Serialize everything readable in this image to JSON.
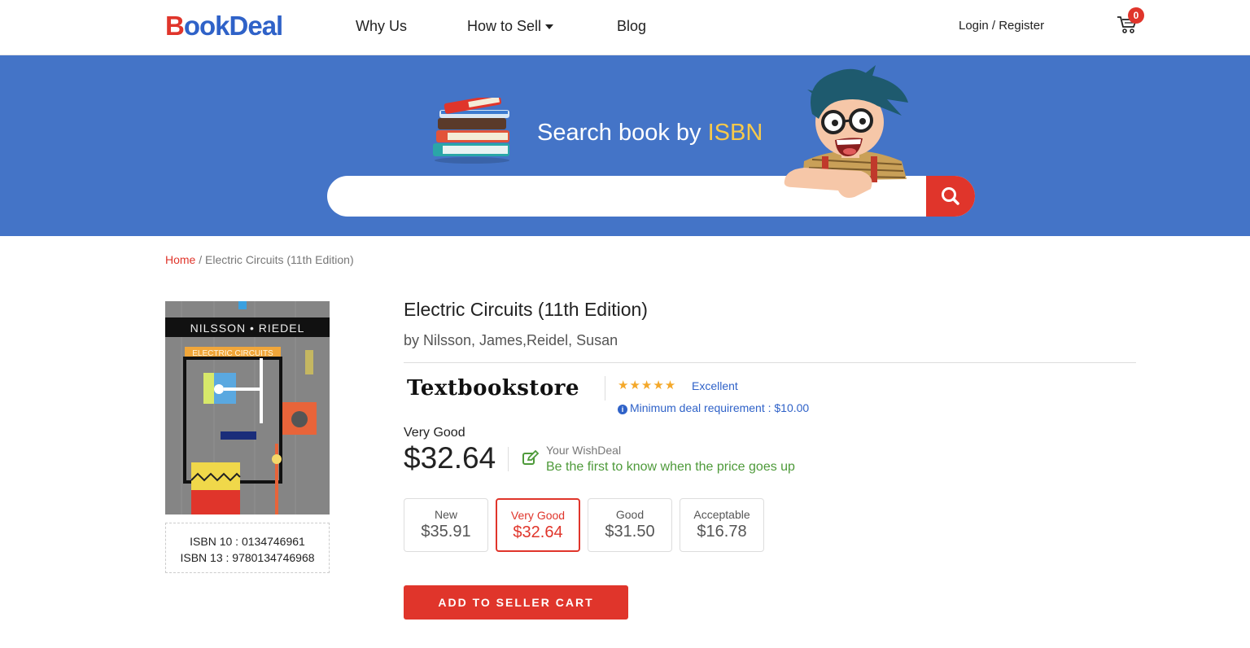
{
  "header": {
    "logo_b": "B",
    "logo_rest": "ookDeal",
    "nav": {
      "why_us": "Why Us",
      "how_to_sell": "How to Sell",
      "blog": "Blog"
    },
    "login": "Login / Register",
    "cart_count": "0"
  },
  "banner": {
    "title_prefix": "Search book by ",
    "title_highlight": "ISBN",
    "search_placeholder": ""
  },
  "breadcrumb": {
    "home": "Home",
    "separator": " / ",
    "current": "Electric Circuits (11th Edition)"
  },
  "book": {
    "title": "Electric Circuits (11th Edition)",
    "authors": "by Nilsson, James,Reidel, Susan",
    "cover_authors": "NILSSON • RIEDEL",
    "cover_title": "ELECTRIC CIRCUITS",
    "isbn10": "ISBN 10 : 0134746961",
    "isbn13": "ISBN 13 : 9780134746968"
  },
  "seller": {
    "name": "Textbookstore",
    "stars": "★★★★★",
    "rating_label": "Excellent",
    "min_deal": "Minimum deal requirement : $10.00"
  },
  "offer": {
    "condition": "Very Good",
    "price": "$32.64",
    "wish_label": "Your WishDeal",
    "wish_text": "Be the first to know when the price goes up"
  },
  "conditions": [
    {
      "label": "New",
      "price": "$35.91"
    },
    {
      "label": "Very Good",
      "price": "$32.64"
    },
    {
      "label": "Good",
      "price": "$31.50"
    },
    {
      "label": "Acceptable",
      "price": "$16.78"
    }
  ],
  "cta": {
    "add_to_cart": "ADD TO SELLER CART"
  },
  "colors": {
    "brand_red": "#e0352b",
    "brand_blue": "#2f62c8",
    "banner_blue": "#4474c7",
    "highlight_yellow": "#f7c94a",
    "wish_green": "#4e9a3a"
  },
  "icons": [
    "cart-icon",
    "search-icon",
    "info-icon",
    "edit-icon",
    "star-icon"
  ]
}
